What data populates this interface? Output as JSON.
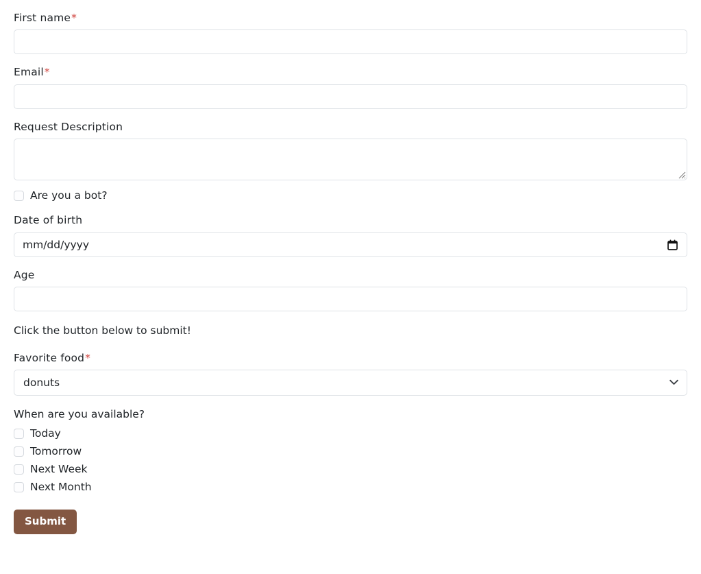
{
  "form": {
    "fields": [
      {
        "id": "first-name",
        "label": "First name",
        "required": true,
        "required_marker": "*",
        "type": "text",
        "value": "",
        "placeholder": ""
      },
      {
        "id": "email",
        "label": "Email",
        "required": true,
        "required_marker": "*",
        "type": "text",
        "value": "",
        "placeholder": ""
      },
      {
        "id": "request-description",
        "label": "Request Description",
        "required": false,
        "type": "textarea",
        "value": "",
        "placeholder": ""
      }
    ],
    "bot_checkbox": {
      "label": "Are you a bot?",
      "checked": false
    },
    "date_of_birth": {
      "label": "Date of birth",
      "placeholder": "mm/dd/yyyy",
      "value": "",
      "icon": "calendar-icon"
    },
    "age": {
      "label": "Age",
      "value": "",
      "placeholder": ""
    },
    "instruction_text": "Click the button below to submit!",
    "favorite_food": {
      "label": "Favorite food",
      "required": true,
      "required_marker": "*",
      "selected": "donuts",
      "icon": "chevron-down-icon"
    },
    "availability": {
      "label": "When are you available?",
      "options": [
        {
          "label": "Today",
          "checked": false
        },
        {
          "label": "Tomorrow",
          "checked": false
        },
        {
          "label": "Next Week",
          "checked": false
        },
        {
          "label": "Next Month",
          "checked": false
        }
      ]
    },
    "submit": {
      "label": "Submit"
    }
  },
  "colors": {
    "accent_button": "#835742",
    "required_asterisk": "#d0453f",
    "border": "#dee2e6",
    "text": "#212529",
    "background": "#ffffff"
  }
}
